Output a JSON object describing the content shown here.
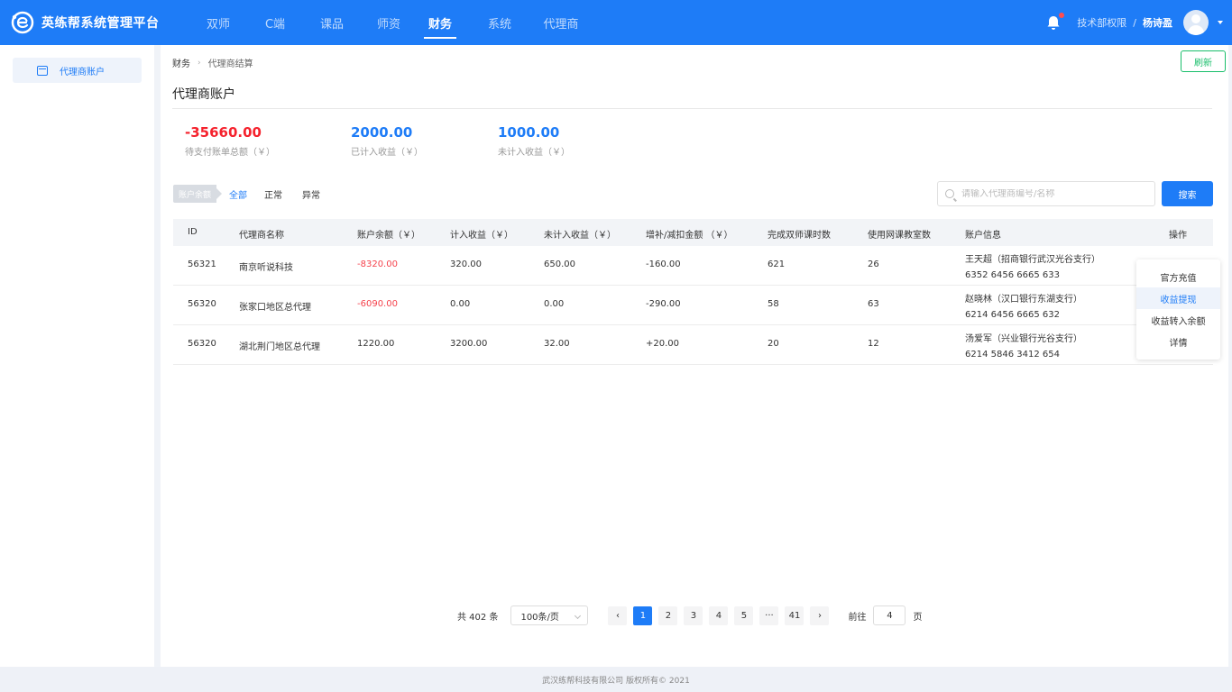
{
  "brand": {
    "name": "英练帮系统管理平台"
  },
  "nav": [
    "双师",
    "C端",
    "课品",
    "师资",
    "财务",
    "系统",
    "代理商"
  ],
  "nav_active": "财务",
  "header": {
    "permission": "技术部权限",
    "separator": "/",
    "user": "杨诗盈"
  },
  "sidebar": {
    "item": "代理商账户"
  },
  "breadcrumb": {
    "root": "财务",
    "current": "代理商结算"
  },
  "refresh_label": "刷新",
  "page_title": "代理商账户",
  "stats": [
    {
      "value": "-35660.00",
      "label": "待支付账单总额（￥）",
      "color": "#f5222d"
    },
    {
      "value": "2000.00",
      "label": "已计入收益（￥）",
      "color": "#1e7cf7"
    },
    {
      "value": "1000.00",
      "label": "未计入收益（￥）",
      "color": "#1e7cf7"
    }
  ],
  "filter": {
    "tag": "账户余额",
    "options": [
      "全部",
      "正常",
      "异常"
    ],
    "active": "全部"
  },
  "search": {
    "placeholder": "请输入代理商编号/名称",
    "button": "搜索"
  },
  "table": {
    "columns": [
      "ID",
      "代理商名称",
      "账户余额（￥）",
      "计入收益（￥）",
      "未计入收益（￥）",
      "增补/减扣金额 （￥）",
      "完成双师课时数",
      "使用网课教室数",
      "账户信息",
      "操作"
    ],
    "rows": [
      {
        "id": "56321",
        "name": "南京听说科技",
        "balance": "-8320.00",
        "balance_negative": true,
        "income": "320.00",
        "pending": "650.00",
        "adjust": "-160.00",
        "hours": "621",
        "rooms": "26",
        "holder": "王天超（招商银行武汉光谷支行）",
        "account": "6352 6456 6665 633"
      },
      {
        "id": "56320",
        "name": "张家口地区总代理",
        "balance": "-6090.00",
        "balance_negative": true,
        "income": "0.00",
        "pending": "0.00",
        "adjust": "-290.00",
        "hours": "58",
        "rooms": "63",
        "holder": "赵晓林（汉口银行东湖支行）",
        "account": "6214 6456 6665 632"
      },
      {
        "id": "56320",
        "name": "湖北荆门地区总代理",
        "balance": "1220.00",
        "balance_negative": false,
        "income": "3200.00",
        "pending": "32.00",
        "adjust": "+20.00",
        "hours": "20",
        "rooms": "12",
        "holder": "汤爱军（兴业银行光谷支行）",
        "account": "6214 5846 3412 654"
      }
    ]
  },
  "action_menu": {
    "items": [
      "官方充值",
      "收益提现",
      "收益转入余额",
      "详情"
    ],
    "highlighted": "收益提现"
  },
  "pagination": {
    "total": "共 402 条",
    "page_size": "100条/页",
    "pages": [
      "1",
      "2",
      "3",
      "4",
      "5",
      "···",
      "41"
    ],
    "current": "1",
    "goto_label": "前往",
    "goto_value": "4",
    "goto_suffix": "页"
  },
  "footer": "武汉练帮科技有限公司 版权所有© 2021"
}
